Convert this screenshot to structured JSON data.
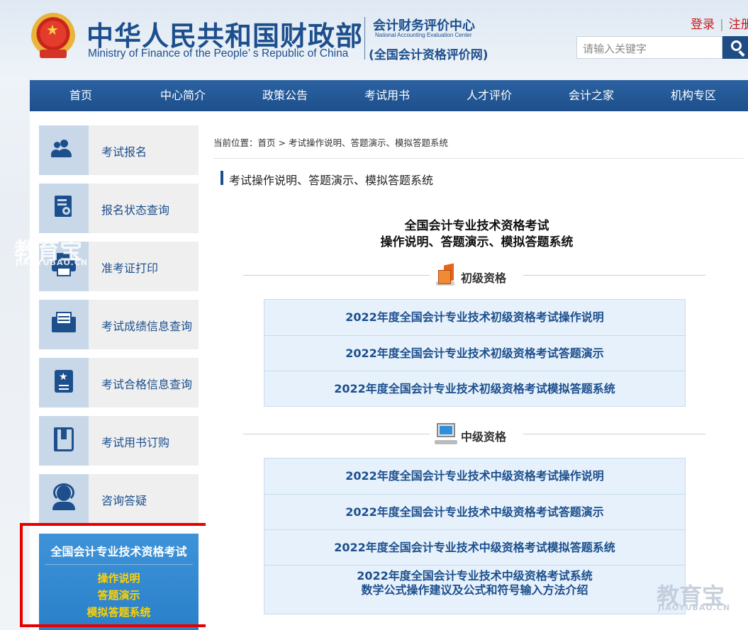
{
  "header": {
    "ministry_cn": "中华人民共和国财政部",
    "ministry_en": "Ministry of Finance of the People’ s Republic of China",
    "center_cn": "会计财务评价中心",
    "center_en": "National Accounting Evaluation Center",
    "center_sub": "(全国会计资格评价网)",
    "login": "登录",
    "register": "注册",
    "auth_sep": "|",
    "search_placeholder": "请输入关键字"
  },
  "nav": {
    "items": [
      "首页",
      "中心简介",
      "政策公告",
      "考试用书",
      "人才评价",
      "会计之家",
      "机构专区"
    ]
  },
  "sidebar": {
    "items": [
      {
        "label": "考试报名",
        "icon": "users-icon"
      },
      {
        "label": "报名状态查询",
        "icon": "document-search-icon"
      },
      {
        "label": "准考证打印",
        "icon": "printer-icon"
      },
      {
        "label": "考试成绩信息查询",
        "icon": "inbox-tray-icon"
      },
      {
        "label": "考试合格信息查询",
        "icon": "certificate-icon"
      },
      {
        "label": "考试用书订购",
        "icon": "book-icon"
      },
      {
        "label": "咨询答疑",
        "icon": "headset-icon"
      }
    ],
    "promo": {
      "title": "全国会计专业技术资格考试",
      "links": [
        "操作说明",
        "答题演示",
        "模拟答题系统"
      ]
    }
  },
  "main": {
    "breadcrumb": {
      "prefix": "当前位置：",
      "home": "首页",
      "sep": ">",
      "current": "考试操作说明、答题演示、模拟答题系统"
    },
    "title": "考试操作说明、答题演示、模拟答题系统",
    "intro_line1": "全国会计专业技术资格考试",
    "intro_line2": "操作说明、答题演示、模拟答题系统",
    "sections": [
      {
        "label": "初级资格",
        "icon": "books-icon",
        "links": [
          "2022年度全国会计专业技术初级资格考试操作说明",
          "2022年度全国会计专业技术初级资格考试答题演示",
          "2022年度全国会计专业技术初级资格考试模拟答题系统"
        ]
      },
      {
        "label": "中级资格",
        "icon": "computer-icon",
        "links": [
          "2022年度全国会计专业技术中级资格考试操作说明",
          "2022年度全国会计专业技术中级资格考试答题演示",
          "2022年度全国会计专业技术中级资格考试模拟答题系统"
        ],
        "extra_link": {
          "line1": "2022年度全国会计专业技术中级资格考试系统",
          "line2": "数学公式操作建议及公式和符号输入方法介绍"
        }
      }
    ]
  },
  "watermark": {
    "text": "教育宝",
    "sub": "JIAOYUBAO.CN"
  },
  "colors": {
    "brand_blue": "#1d4f8d",
    "nav_blue": "#2b62a2",
    "promo_blue": "#3e93d8",
    "promo_link": "#ffd200",
    "auth_red": "#c61a1a",
    "highlight_red": "#e60000"
  }
}
